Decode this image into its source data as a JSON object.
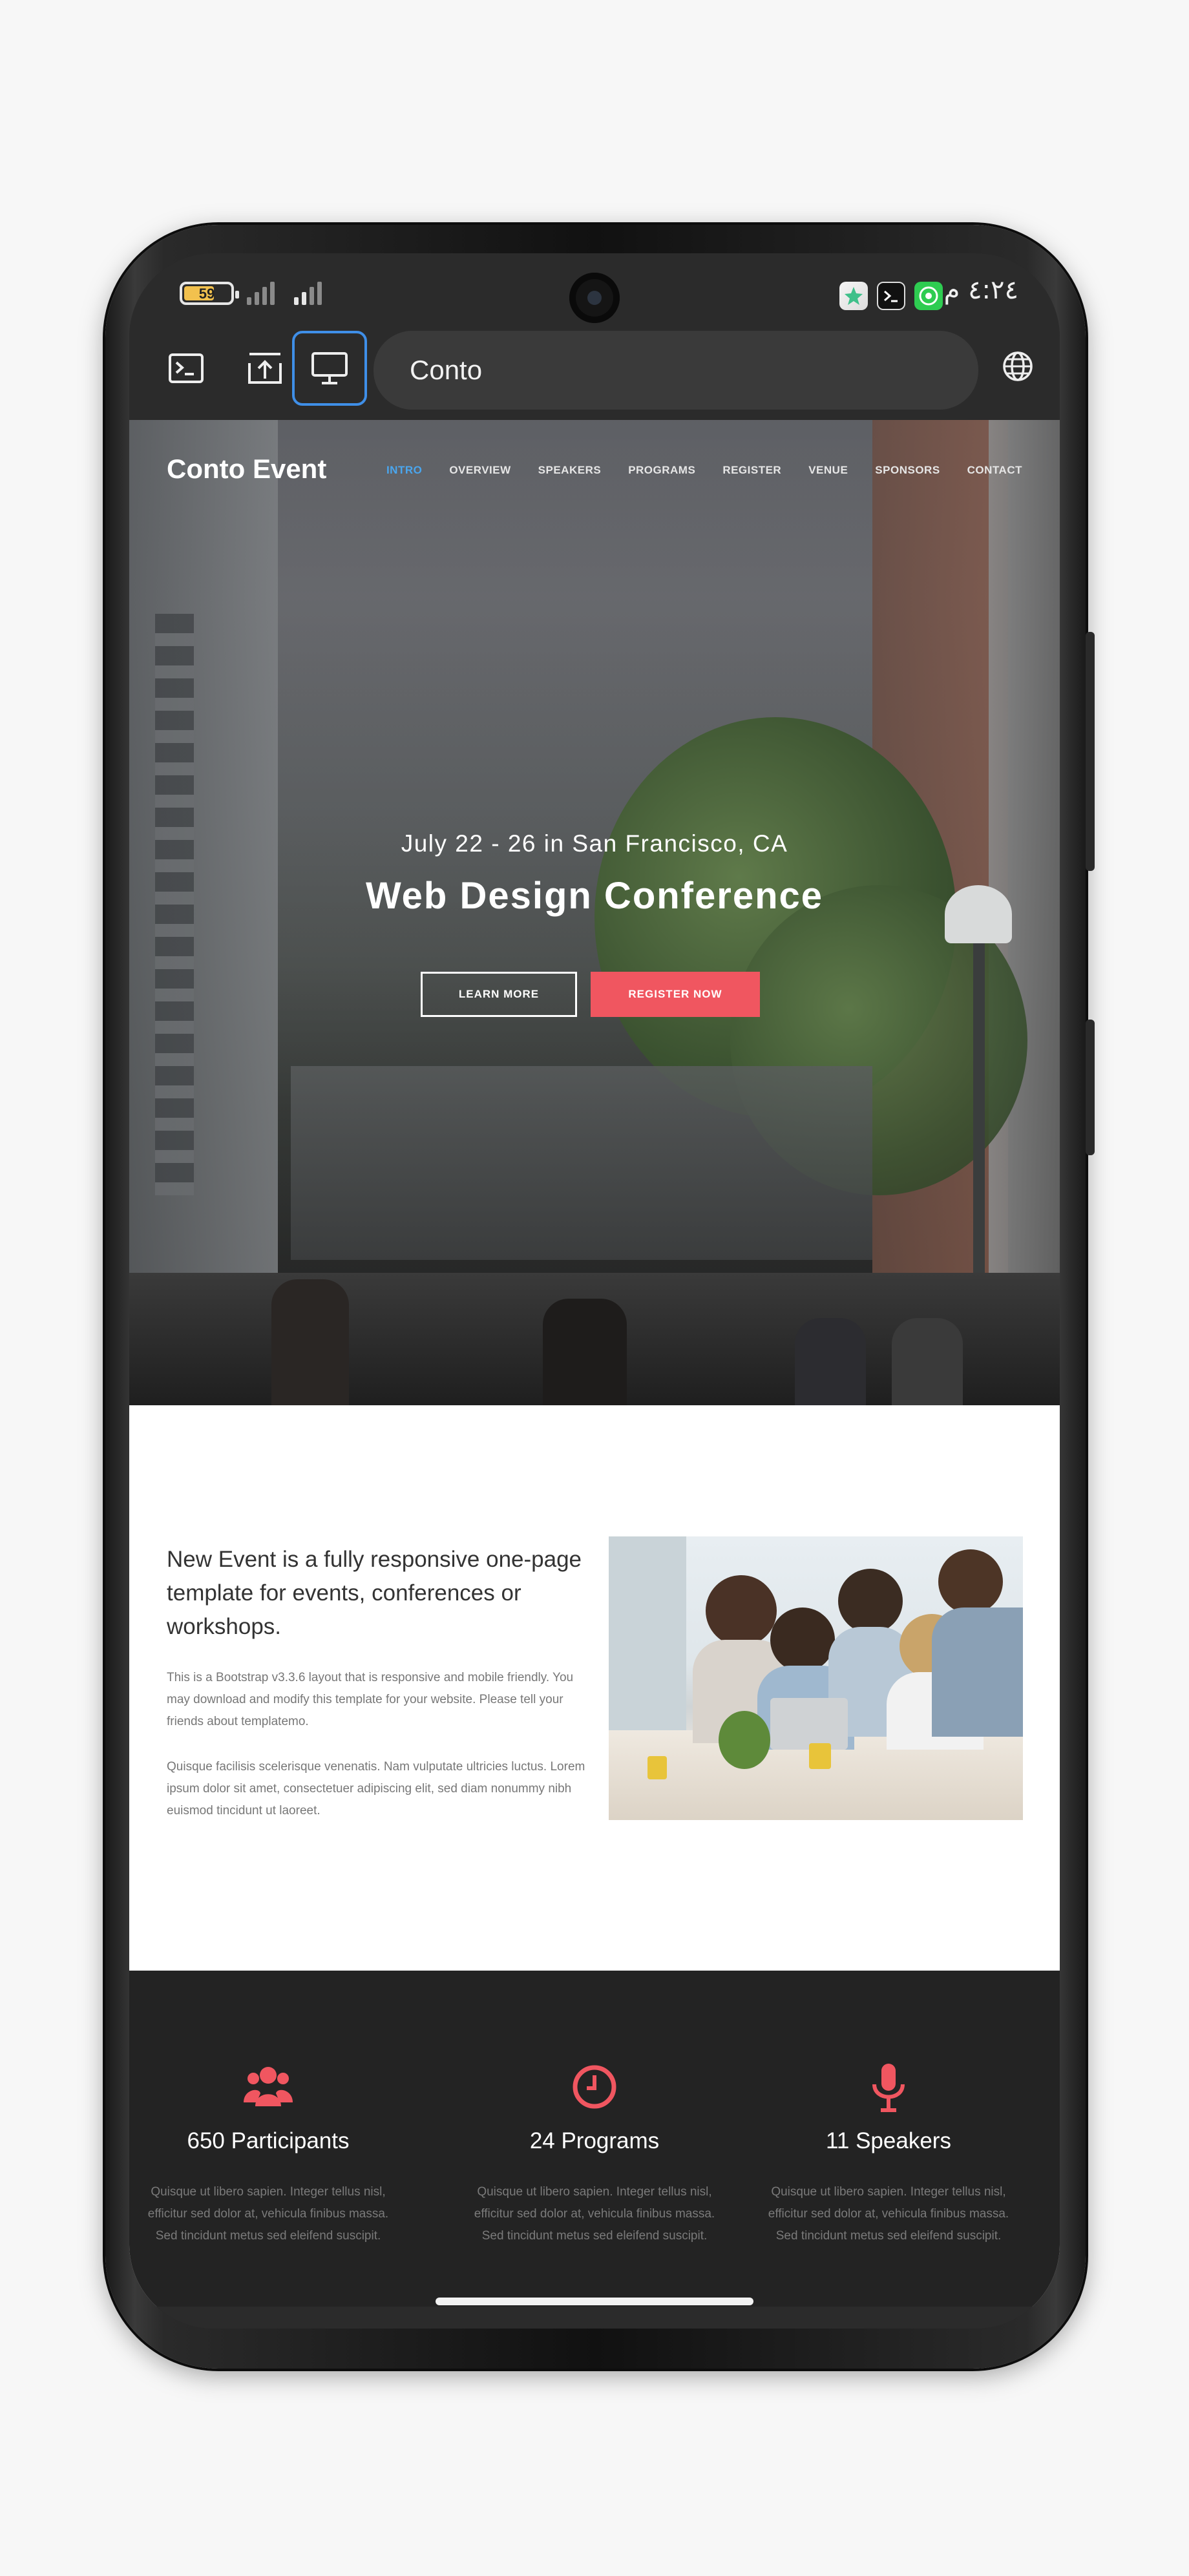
{
  "status_bar": {
    "battery_level": "59",
    "clock": "٤:٢٤ م",
    "icons": [
      "battery-icon",
      "signal-weak-icon",
      "signal-icon",
      "app-store-icon",
      "terminal-app-icon",
      "chat-app-icon"
    ]
  },
  "browser": {
    "url_text": "Conto",
    "buttons": [
      "terminal-icon",
      "upload-icon",
      "desktop-mode-icon",
      "globe-icon"
    ]
  },
  "site": {
    "brand": "Conto Event",
    "nav": [
      "INTRO",
      "OVERVIEW",
      "SPEAKERS",
      "PROGRAMS",
      "REGISTER",
      "VENUE",
      "SPONSORS",
      "CONTACT"
    ],
    "active_nav": "INTRO",
    "hero": {
      "subtitle": "July 22 - 26 in San Francisco, CA",
      "title": "Web Design Conference",
      "learn_more": "LEARN MORE",
      "register_now": "REGISTER NOW"
    },
    "about": {
      "heading": "New Event is a fully responsive one-page template for events, conferences or workshops.",
      "paragraph1": "This is a Bootstrap v3.3.6 layout that is responsive and mobile friendly. You may download and modify this template for your website. Please tell your friends about templatemo.",
      "paragraph2": "Quisque facilisis scelerisque venenatis. Nam vulputate ultricies luctus. Lorem ipsum dolor sit amet, consectetuer adipiscing elit, sed diam nonummy nibh euismod tincidunt ut laoreet."
    },
    "features": [
      {
        "icon": "users-icon",
        "title": "650 Participants",
        "text": "Quisque ut libero sapien. Integer tellus nisl, efficitur sed dolor at, vehicula finibus massa. Sed tincidunt metus sed eleifend suscipit."
      },
      {
        "icon": "clock-icon",
        "title": "24 Programs",
        "text": "Quisque ut libero sapien. Integer tellus nisl, efficitur sed dolor at, vehicula finibus massa. Sed tincidunt metus sed eleifend suscipit."
      },
      {
        "icon": "microphone-icon",
        "title": "11 Speakers",
        "text": "Quisque ut libero sapien. Integer tellus nisl, efficitur sed dolor at, vehicula finibus massa. Sed tincidunt metus sed eleifend suscipit."
      }
    ],
    "accent_color": "#f05660",
    "nav_active_color": "#4aa6ee"
  }
}
